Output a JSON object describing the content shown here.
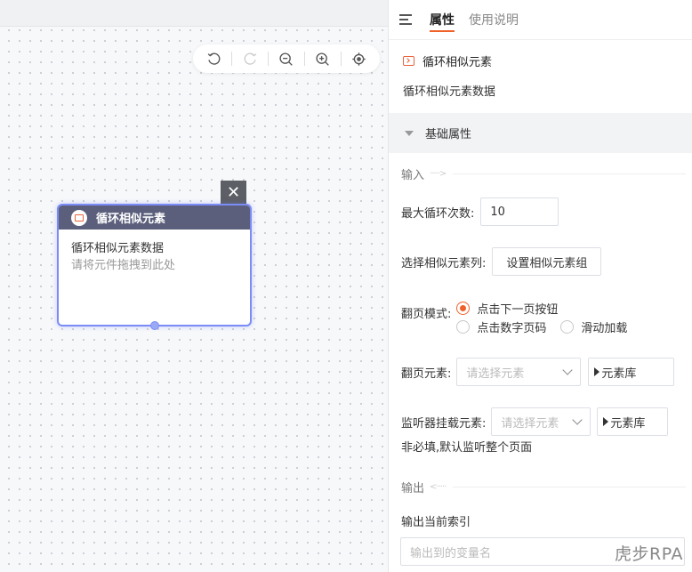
{
  "canvas": {
    "toolbar": {
      "undo": "undo-icon",
      "redo": "redo-icon",
      "zoom_out": "zoom-out-icon",
      "zoom_in": "zoom-in-icon",
      "locate": "locate-icon"
    },
    "node": {
      "close_glyph": "✕",
      "title": "循环相似元素",
      "desc": "循环相似元素数据",
      "hint": "请将元件拖拽到此处"
    }
  },
  "panel": {
    "tabs": [
      {
        "label": "属性",
        "active": true
      },
      {
        "label": "使用说明",
        "active": false
      }
    ],
    "component_title": "循环相似元素",
    "component_desc": "循环相似元素数据",
    "section_basic": "基础属性",
    "input_group": "输入",
    "max_loop_label": "最大循环次数:",
    "max_loop_value": "10",
    "select_list_label": "选择相似元素列:",
    "select_list_button": "设置相似元素组",
    "page_mode_label": "翻页模式:",
    "page_mode_options": [
      "点击下一页按钮",
      "点击数字页码",
      "滑动加载"
    ],
    "page_mode_selected": "点击下一页按钮",
    "page_element_label": "翻页元素:",
    "page_element_placeholder": "请选择元素",
    "element_lib_label": "元素库",
    "listener_label": "监听器挂载元素:",
    "listener_placeholder": "请选择元素",
    "listener_lib_label": "元素库",
    "listener_note": "非必填,默认监听整个页面",
    "output_group": "输出",
    "output_index_label": "输出当前索引",
    "output_var_placeholder": "输出到的变量名"
  },
  "watermark": "虎步RPA",
  "colors": {
    "accent": "#f0612a",
    "node_header": "#5b5f7b",
    "node_border": "#7b8cf7"
  }
}
